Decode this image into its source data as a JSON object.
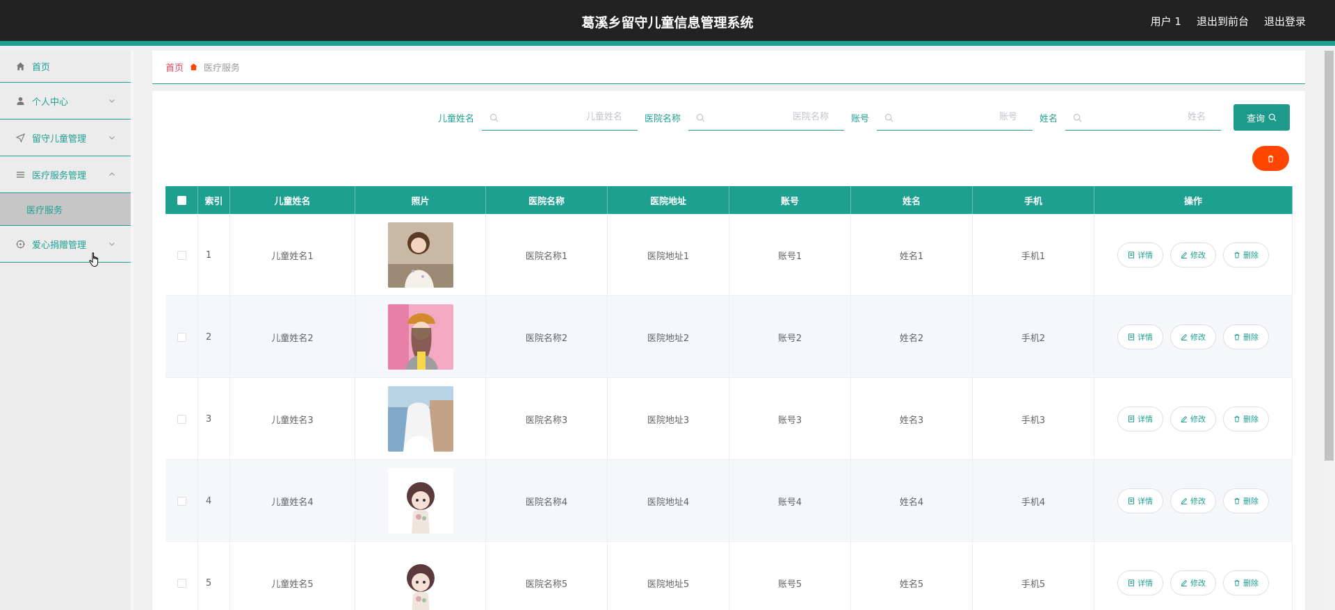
{
  "header": {
    "title": "葛溪乡留守儿童信息管理系统",
    "user": "用户 1",
    "to_front": "退出到前台",
    "logout": "退出登录"
  },
  "sidebar": {
    "items": [
      {
        "label": "首页",
        "icon": "home-icon"
      },
      {
        "label": "个人中心",
        "icon": "user-icon"
      },
      {
        "label": "留守儿童管理",
        "icon": "send-icon"
      },
      {
        "label": "医疗服务管理",
        "icon": "list-icon"
      },
      {
        "label": "爱心捐赠管理",
        "icon": "target-icon"
      }
    ],
    "submenu": {
      "label": "医疗服务"
    }
  },
  "breadcrumb": {
    "home": "首页",
    "current": "医疗服务"
  },
  "search": {
    "child_name_label": "儿童姓名",
    "child_name_placeholder": "儿童姓名",
    "hospital_label": "医院名称",
    "hospital_placeholder": "医院名称",
    "account_label": "账号",
    "account_placeholder": "账号",
    "name_label": "姓名",
    "name_placeholder": "姓名",
    "query_label": "查询"
  },
  "table": {
    "headers": [
      "索引",
      "儿童姓名",
      "照片",
      "医院名称",
      "医院地址",
      "账号",
      "姓名",
      "手机",
      "操作"
    ],
    "actions": {
      "detail": "详情",
      "edit": "修改",
      "delete": "删除"
    },
    "rows": [
      {
        "index": "1",
        "child": "儿童姓名1",
        "hospital": "医院名称1",
        "address": "医院地址1",
        "account": "账号1",
        "name": "姓名1",
        "phone": "手机1"
      },
      {
        "index": "2",
        "child": "儿童姓名2",
        "hospital": "医院名称2",
        "address": "医院地址2",
        "account": "账号2",
        "name": "姓名2",
        "phone": "手机2"
      },
      {
        "index": "3",
        "child": "儿童姓名3",
        "hospital": "医院名称3",
        "address": "医院地址3",
        "account": "账号3",
        "name": "姓名3",
        "phone": "手机3"
      },
      {
        "index": "4",
        "child": "儿童姓名4",
        "hospital": "医院名称4",
        "address": "医院地址4",
        "account": "账号4",
        "name": "姓名4",
        "phone": "手机4"
      },
      {
        "index": "5",
        "child": "儿童姓名5",
        "hospital": "医院名称5",
        "address": "医院地址5",
        "account": "账号5",
        "name": "姓名5",
        "phone": "手机5"
      }
    ]
  },
  "colors": {
    "accent": "#1ea091",
    "header_bg": "#222222",
    "danger": "#ff4500",
    "home_link": "#e8465c"
  }
}
